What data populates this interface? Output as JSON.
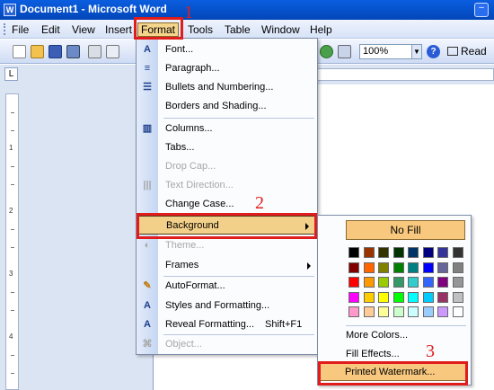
{
  "window": {
    "title": "Document1 - Microsoft Word",
    "app_icon_letter": "W"
  },
  "menubar": {
    "items": [
      "File",
      "Edit",
      "View",
      "Insert",
      "Format",
      "Tools",
      "Table",
      "Window",
      "Help"
    ],
    "active": "Format"
  },
  "toolbar": {
    "zoom": "100%",
    "read_label": "Read"
  },
  "format_menu": {
    "items": [
      {
        "label": "Font...",
        "icon": "font-A-icon",
        "enabled": true
      },
      {
        "label": "Paragraph...",
        "icon": "paragraph-icon",
        "enabled": true
      },
      {
        "label": "Bullets and Numbering...",
        "icon": "bullets-icon",
        "enabled": true
      },
      {
        "label": "Borders and Shading...",
        "icon": "",
        "enabled": true
      },
      {
        "label": "Columns...",
        "icon": "columns-icon",
        "enabled": true
      },
      {
        "label": "Tabs...",
        "icon": "",
        "enabled": true
      },
      {
        "label": "Drop Cap...",
        "icon": "",
        "enabled": false
      },
      {
        "label": "Text Direction...",
        "icon": "text-direction-icon",
        "enabled": false
      },
      {
        "label": "Change Case...",
        "icon": "",
        "enabled": true
      },
      {
        "label": "Background",
        "icon": "",
        "enabled": true,
        "submenu": true,
        "highlighted": true
      },
      {
        "label": "Theme...",
        "icon": "theme-icon",
        "enabled": false
      },
      {
        "label": "Frames",
        "icon": "",
        "enabled": true,
        "submenu": true
      },
      {
        "label": "AutoFormat...",
        "icon": "autoformat-icon",
        "enabled": true
      },
      {
        "label": "Styles and Formatting...",
        "icon": "styles-icon",
        "enabled": true
      },
      {
        "label": "Reveal Formatting...",
        "icon": "reveal-formatting-icon",
        "enabled": true,
        "shortcut": "Shift+F1"
      },
      {
        "label": "Object...",
        "icon": "object-icon",
        "enabled": false
      }
    ]
  },
  "background_submenu": {
    "no_fill": "No Fill",
    "more_colors": "More Colors...",
    "fill_effects": "Fill Effects...",
    "printed_watermark": "Printed Watermark...",
    "palette": [
      [
        "#000000",
        "#993300",
        "#333300",
        "#003300",
        "#003366",
        "#000080",
        "#333399",
        "#333333"
      ],
      [
        "#800000",
        "#FF6600",
        "#808000",
        "#008000",
        "#008080",
        "#0000FF",
        "#666699",
        "#808080"
      ],
      [
        "#FF0000",
        "#FF9900",
        "#99CC00",
        "#339966",
        "#33CCCC",
        "#3366FF",
        "#800080",
        "#969696"
      ],
      [
        "#FF00FF",
        "#FFCC00",
        "#FFFF00",
        "#00FF00",
        "#00FFFF",
        "#00CCFF",
        "#993366",
        "#C0C0C0"
      ],
      [
        "#FF99CC",
        "#FFCC99",
        "#FFFF99",
        "#CCFFCC",
        "#CCFFFF",
        "#99CCFF",
        "#CC99FF",
        "#FFFFFF"
      ]
    ]
  },
  "annotations": {
    "step1": "1",
    "step2": "2",
    "step3": "3"
  },
  "colors": {
    "title_bar": "#0346b8",
    "menu_highlight": "#f3d08a",
    "callout_red": "#e11c1c"
  }
}
